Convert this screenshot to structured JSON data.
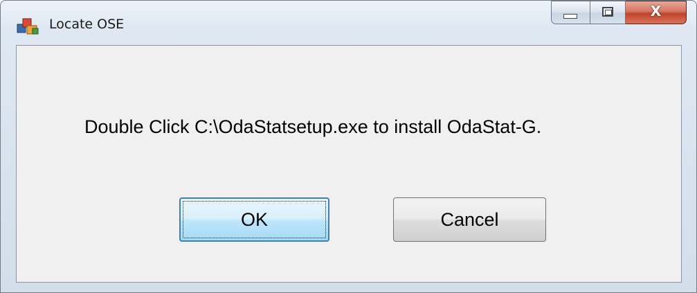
{
  "window": {
    "title": "Locate OSE",
    "close_label": "X"
  },
  "dialog": {
    "message": "Double Click C:\\OdaStatsetup.exe to install OdaStat-G.",
    "ok_label": "OK",
    "cancel_label": "Cancel"
  },
  "icons": {
    "app": "application-icon",
    "minimize": "minimize-icon",
    "maximize": "maximize-icon",
    "close": "close-icon"
  }
}
